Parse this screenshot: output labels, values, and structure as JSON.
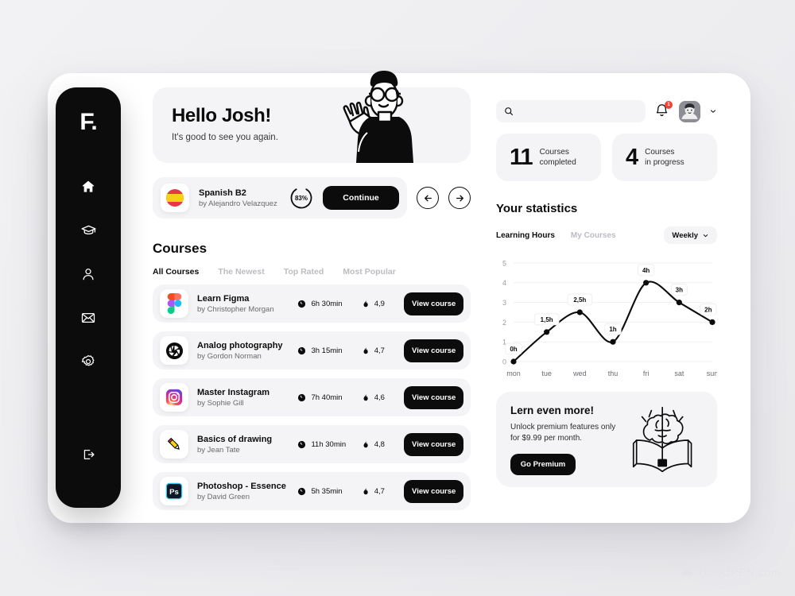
{
  "sidebar": {
    "logo": "F.",
    "items": [
      {
        "name": "home",
        "icon": "home-icon"
      },
      {
        "name": "courses",
        "icon": "graduation-cap-icon"
      },
      {
        "name": "profile",
        "icon": "user-icon"
      },
      {
        "name": "messages",
        "icon": "envelope-icon"
      },
      {
        "name": "settings",
        "icon": "gear-icon"
      }
    ],
    "logout": {
      "name": "logout",
      "icon": "logout-icon"
    }
  },
  "hero": {
    "title": "Hello Josh!",
    "subtitle": "It's good to see you again.",
    "illustration": "waving-person-illustration"
  },
  "current_course": {
    "icon": "spain-flag-icon",
    "title": "Spanish B2",
    "author": "by Alejandro Velazquez",
    "progress_label": "83%",
    "progress_value": 83,
    "continue_label": "Continue",
    "prev_icon": "arrow-left-icon",
    "next_icon": "arrow-right-icon"
  },
  "courses": {
    "title": "Courses",
    "tabs": [
      {
        "label": "All Courses",
        "active": true
      },
      {
        "label": "The Newest",
        "active": false
      },
      {
        "label": "Top Rated",
        "active": false
      },
      {
        "label": "Most Popular",
        "active": false
      }
    ],
    "duration_icon": "clock-icon",
    "rating_icon": "flame-icon",
    "action_label": "View course",
    "items": [
      {
        "icon": "figma-icon",
        "title": "Learn Figma",
        "author": "by Christopher Morgan",
        "duration": "6h 30min",
        "rating": "4,9"
      },
      {
        "icon": "aperture-icon",
        "title": "Analog photography",
        "author": "by Gordon Norman",
        "duration": "3h 15min",
        "rating": "4,7"
      },
      {
        "icon": "instagram-icon",
        "title": "Master Instagram",
        "author": "by Sophie Gill",
        "duration": "7h 40min",
        "rating": "4,6"
      },
      {
        "icon": "pencil-icon",
        "title": "Basics of drawing",
        "author": "by Jean Tate",
        "duration": "11h 30min",
        "rating": "4,8"
      },
      {
        "icon": "photoshop-icon",
        "title": "Photoshop - Essence",
        "author": "by David Green",
        "duration": "5h 35min",
        "rating": "4,7"
      }
    ]
  },
  "topbar": {
    "search_placeholder": "",
    "search_value": "",
    "search_icon": "search-icon",
    "bell_icon": "bell-icon",
    "bell_badge": "1",
    "avatar": "user-avatar",
    "chevron_icon": "chevron-down-icon",
    "badge_color": "#f04438"
  },
  "stats": [
    {
      "number": "11",
      "label_line1": "Courses",
      "label_line2": "completed"
    },
    {
      "number": "4",
      "label_line1": "Courses",
      "label_line2": "in progress"
    }
  ],
  "statistics": {
    "title": "Your statistics",
    "tabs": [
      {
        "label": "Learning Hours",
        "active": true
      },
      {
        "label": "My Courses",
        "active": false
      }
    ],
    "period": "Weekly",
    "period_chevron": "chevron-down-icon"
  },
  "chart_data": {
    "type": "line",
    "title": "Learning Hours",
    "categories": [
      "mon",
      "tue",
      "wed",
      "thu",
      "fri",
      "sat",
      "sun"
    ],
    "values": [
      0,
      1.5,
      2.5,
      1,
      4,
      3,
      2
    ],
    "point_labels": [
      "0h",
      "1,5h",
      "2,5h",
      "1h",
      "4h",
      "3h",
      "2h"
    ],
    "yticks": [
      0,
      1,
      2,
      3,
      4,
      5
    ],
    "ylim": [
      0,
      5
    ],
    "xlabel": "",
    "ylabel": "",
    "grid": true,
    "legend": "none",
    "line_color": "#0c0c0c",
    "point_color": "#0c0c0c"
  },
  "premium": {
    "title": "Lern even more!",
    "subtitle": "Unlock premium features only for $9.99 per month.",
    "button_label": "Go Premium",
    "illustration": "brain-book-icon"
  },
  "watermark": {
    "text": "TOOOPEN.com",
    "icon": "cloud-icon"
  }
}
